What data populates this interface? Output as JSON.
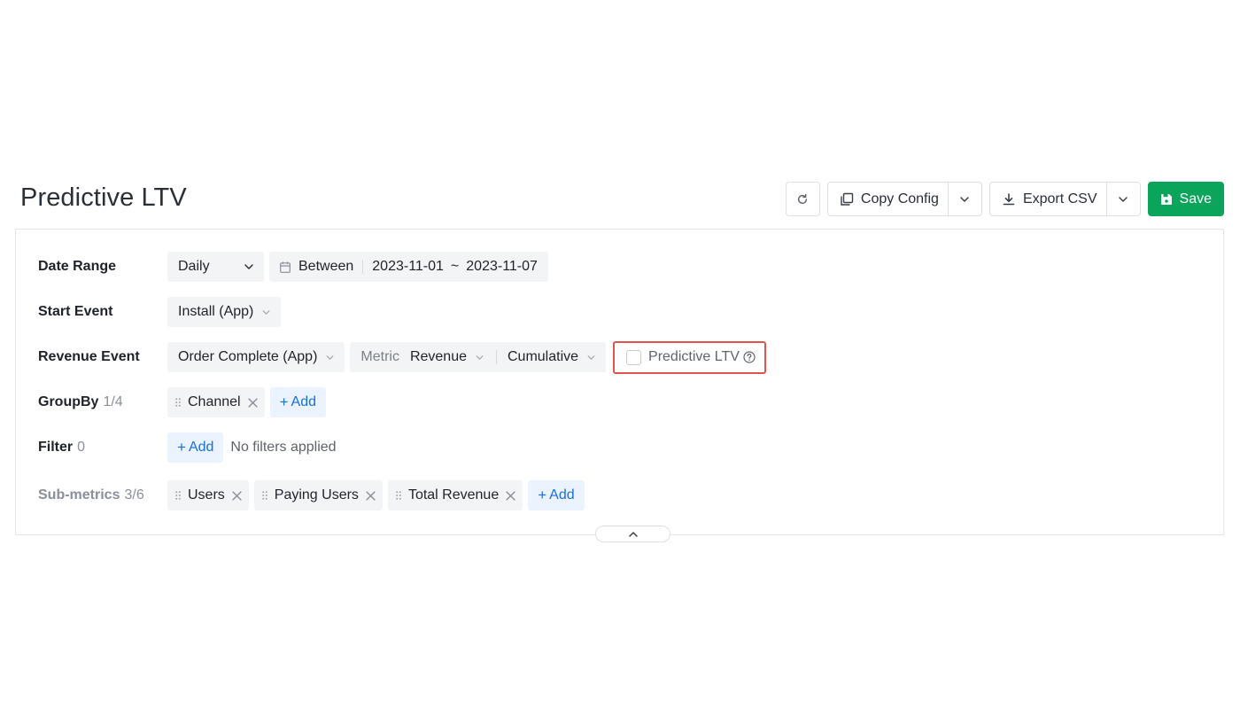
{
  "header": {
    "title": "Predictive LTV",
    "copy_config_label": "Copy Config",
    "export_csv_label": "Export CSV",
    "save_label": "Save"
  },
  "rows": {
    "date_range": {
      "label": "Date Range",
      "granularity": "Daily",
      "operator": "Between",
      "start": "2023-11-01",
      "tilde": "~",
      "end": "2023-11-07"
    },
    "start_event": {
      "label": "Start Event",
      "value": "Install (App)"
    },
    "revenue_event": {
      "label": "Revenue Event",
      "value": "Order Complete (App)",
      "metric_label": "Metric",
      "metric_value": "Revenue",
      "mode": "Cumulative",
      "predictive_label": "Predictive LTV",
      "predictive_checked": false
    },
    "groupby": {
      "label": "GroupBy",
      "count": "1/4",
      "items": [
        "Channel"
      ],
      "add_label": "Add"
    },
    "filter": {
      "label": "Filter",
      "count": "0",
      "add_label": "Add",
      "empty_text": "No filters applied"
    },
    "submetrics": {
      "label": "Sub-metrics",
      "count": "3/6",
      "items": [
        "Users",
        "Paying Users",
        "Total Revenue"
      ],
      "add_label": "Add"
    }
  },
  "colors": {
    "accent_green": "#0aa55b",
    "highlight_red": "#e0534e",
    "add_blue": "#1a6fe0"
  },
  "icons": {
    "refresh": "refresh-icon",
    "copy": "copy-icon",
    "download": "download-icon",
    "save": "save-icon",
    "calendar": "calendar-icon",
    "chevron": "chevron-down-icon",
    "grip": "drag-handle-icon",
    "remove": "close-icon",
    "help": "help-icon",
    "collapse": "chevron-up-icon"
  }
}
